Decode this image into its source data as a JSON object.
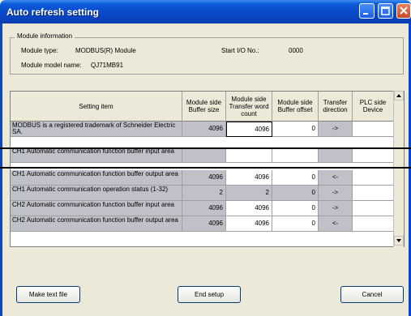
{
  "window": {
    "title": "Auto refresh setting"
  },
  "module_info": {
    "legend": "Module information",
    "type_label": "Module type:",
    "type_value": "MODBUS(R) Module",
    "start_io_label": "Start I/O No.:",
    "start_io_value": "0000",
    "model_label": "Module model name:",
    "model_value": "QJ71MB91"
  },
  "table": {
    "headers": {
      "setting_item": "Setting item",
      "module_side_buffer_size": "Module side Buffer size",
      "module_side_transfer_word_count": "Module side Transfer word count",
      "module_side_buffer_offset": "Module side Buffer offset",
      "transfer_direction": "Transfer direction",
      "plc_side_device": "PLC side Device"
    },
    "rows": [
      {
        "item": "MODBUS is a registered trademark of Schneider Electric SA.",
        "buffer_size": "4096",
        "word_count": "4096",
        "offset": "0",
        "direction": "->",
        "device": ""
      },
      {
        "item": "CH1 Automatic communication function buffer input area",
        "buffer_size": "",
        "word_count": "",
        "offset": "",
        "direction": "",
        "device": ""
      },
      {
        "item": "CH1 Automatic communication function buffer output area",
        "buffer_size": "4096",
        "word_count": "4096",
        "offset": "0",
        "direction": "<-",
        "device": ""
      },
      {
        "item": "CH1 Automatic communication operation status (1-32)",
        "buffer_size": "2",
        "word_count": "2",
        "offset": "0",
        "direction": "->",
        "device": ""
      },
      {
        "item": "CH2 Automatic communication function buffer input area",
        "buffer_size": "4096",
        "word_count": "4096",
        "offset": "0",
        "direction": "->",
        "device": ""
      },
      {
        "item": "CH2 Automatic communication function buffer output area",
        "buffer_size": "4096",
        "word_count": "4096",
        "offset": "0",
        "direction": "<-",
        "device": ""
      }
    ]
  },
  "buttons": {
    "make_text_file": "Make text file",
    "end_setup": "End setup",
    "cancel": "Cancel"
  }
}
